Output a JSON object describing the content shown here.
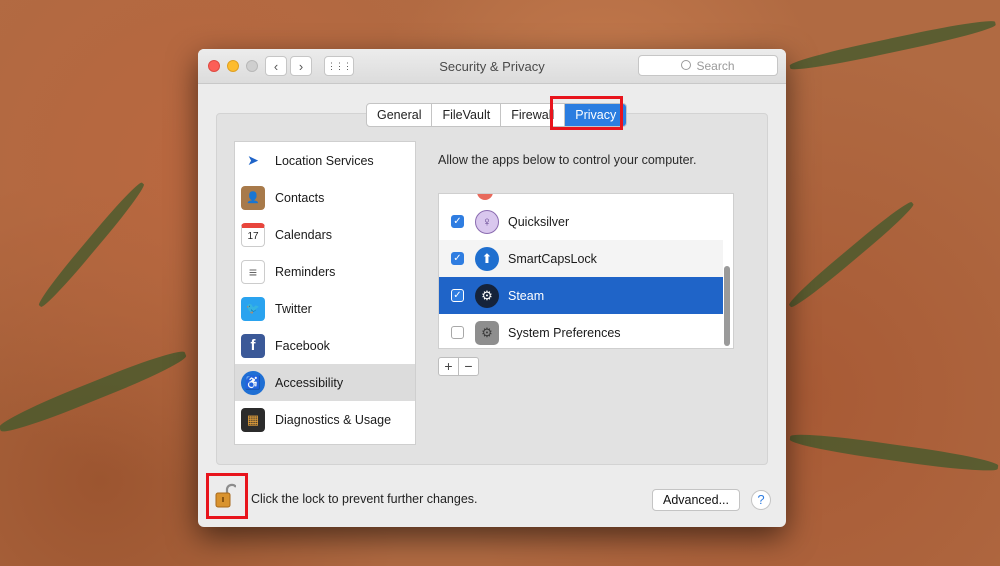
{
  "window": {
    "title": "Security & Privacy",
    "search_placeholder": "Search",
    "back_icon": "‹",
    "forward_icon": "›",
    "grid_icon": "⋮⋮⋮"
  },
  "tabs": [
    {
      "label": "General"
    },
    {
      "label": "FileVault"
    },
    {
      "label": "Firewall"
    },
    {
      "label": "Privacy"
    }
  ],
  "sidebar": {
    "items": [
      {
        "label": "Location Services",
        "icon": "location-arrow-icon",
        "glyph": "➤"
      },
      {
        "label": "Contacts",
        "icon": "contacts-book-icon",
        "glyph": "👤"
      },
      {
        "label": "Calendars",
        "icon": "calendar-icon",
        "glyph": "17"
      },
      {
        "label": "Reminders",
        "icon": "reminders-icon",
        "glyph": "≡"
      },
      {
        "label": "Twitter",
        "icon": "twitter-bird-icon",
        "glyph": "🐦"
      },
      {
        "label": "Facebook",
        "icon": "facebook-icon",
        "glyph": "f"
      },
      {
        "label": "Accessibility",
        "icon": "accessibility-icon",
        "glyph": "♿"
      },
      {
        "label": "Diagnostics & Usage",
        "icon": "diagnostics-icon",
        "glyph": "▦"
      }
    ]
  },
  "main": {
    "allow_text": "Allow the apps below to control your computer.",
    "apps": [
      {
        "name": "Quicksilver",
        "checked": true,
        "check_glyph": "✓",
        "icon": "quicksilver-icon",
        "glyph": "♀"
      },
      {
        "name": "SmartCapsLock",
        "checked": true,
        "check_glyph": "✓",
        "icon": "smartcapslock-icon",
        "glyph": "⬆"
      },
      {
        "name": "Steam",
        "checked": true,
        "check_glyph": "✓",
        "icon": "steam-icon",
        "glyph": "⚙"
      },
      {
        "name": "System Preferences",
        "checked": false,
        "check_glyph": "",
        "icon": "system-preferences-icon",
        "glyph": "⚙"
      }
    ],
    "add_label": "+",
    "remove_label": "−"
  },
  "footer": {
    "lock_text": "Click the lock to prevent further changes.",
    "advanced_label": "Advanced...",
    "help_label": "?"
  },
  "colors": {
    "accent": "#2b7de0",
    "selection": "#1f64c8",
    "highlight_box": "#e8141c"
  }
}
